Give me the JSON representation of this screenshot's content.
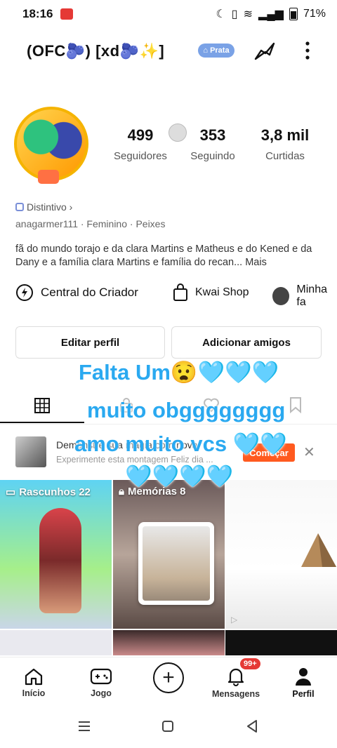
{
  "status_bar": {
    "time": "18:16",
    "battery": "71%"
  },
  "header": {
    "name": "(OFC🫐)  [xd🫐✨]",
    "rank_label": "Prata"
  },
  "stats": [
    {
      "value": "499",
      "label": "Seguidores"
    },
    {
      "value": "353",
      "label": "Seguindo"
    },
    {
      "value": "3,8 mil",
      "label": "Curtidas"
    }
  ],
  "profile": {
    "badge_label": "Distintivo ›",
    "meta": "anagarmer111  ·  Feminino  ·  Peixes",
    "bio": "fã do mundo torajo e da clara Martins e Matheus e do Kened e da Dany e a família clara Martins e família do recan...",
    "bio_more": "Mais"
  },
  "quick_links": {
    "creator": "Central do Criador",
    "shop": "Kwai Shop",
    "fam": "Minha fa"
  },
  "buttons": {
    "edit": "Editar perfil",
    "add_friends": "Adicionar amigos"
  },
  "promo": {
    "title": "Demonstre sua magia com nova",
    "subtitle": "Experimente esta montagem Feliz dia ...",
    "cta": "Começar"
  },
  "grid": {
    "drafts": "Rascunhos 22",
    "memories": "Memórias 8"
  },
  "overlay": {
    "line1": "Falta Um😧🩵🩵🩵",
    "line2": "muito obgggggggg",
    "line3": "amo muito vcs 🩵🩵",
    "line4": "🩵🩵🩵🩵"
  },
  "nav": {
    "home": "Início",
    "game": "Jogo",
    "messages": "Mensagens",
    "messages_badge": "99+",
    "profile": "Perfil"
  }
}
